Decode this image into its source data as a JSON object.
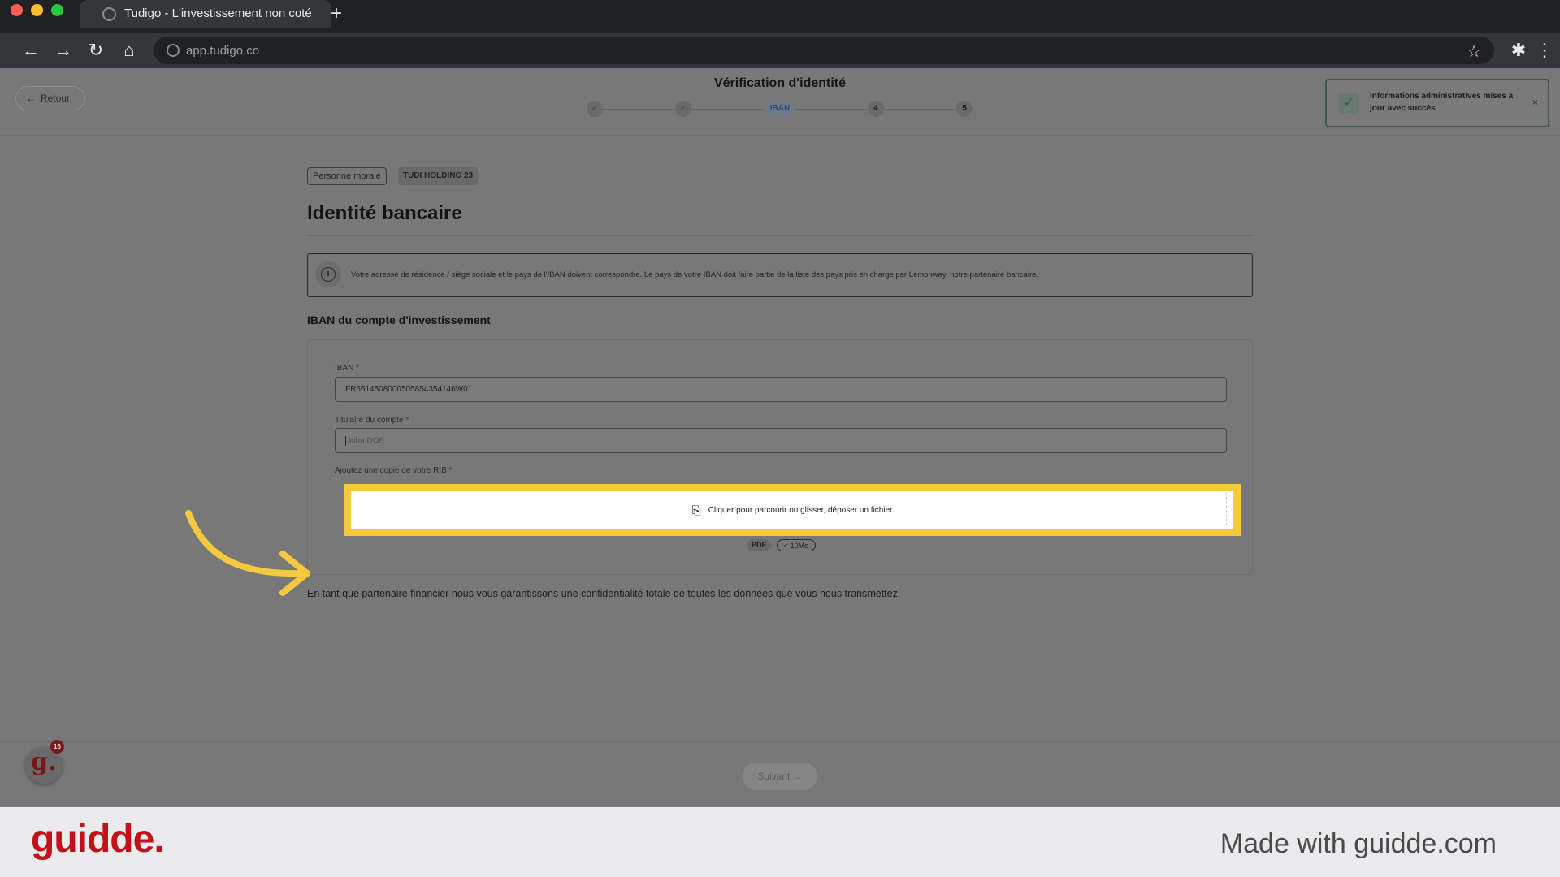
{
  "browser": {
    "tab_title": "Tudigo - L'investissement non coté",
    "new_tab": "+",
    "url": "app.tudigo.co",
    "colors": {
      "close": "#ff5f57",
      "minimize": "#febc2e",
      "maximize": "#28c840"
    }
  },
  "header": {
    "back_label": "Retour",
    "title": "Vérification d'identité",
    "steps": [
      {
        "state": "done",
        "label": "✓"
      },
      {
        "state": "done",
        "label": "✓"
      },
      {
        "state": "active",
        "label": "IBAN"
      },
      {
        "state": "todo",
        "label": "4"
      },
      {
        "state": "todo",
        "label": "5"
      }
    ]
  },
  "toast": {
    "message": "Informations administratives mises à jour avec succès",
    "close": "×"
  },
  "badges": {
    "entity_type": "Personne morale",
    "entity_name": "TUDI HOLDING 23"
  },
  "main": {
    "title": "Identité bancaire",
    "info_icon": "i",
    "info_text": "Votre adresse de résidence / siège sociale et le pays de l'IBAN doivent correspondre. Le pays de votre IBAN doit faire partie de la liste des pays pris en charge par Lemonway, notre partenaire bancaire.",
    "section_title": "IBAN du compte d'investissement",
    "iban": {
      "label": "IBAN",
      "required": "*",
      "value": "FR6514508000505854354146W01"
    },
    "holder": {
      "label": "Titulaire du compte",
      "required": "*",
      "placeholder": "John DOE"
    },
    "rib": {
      "label": "Ajoutez une copie de votre RIB",
      "required": "*",
      "dropzone_text": "Cliquer pour parcourir ou glisser, déposer un fichier",
      "format": "PDF",
      "max_size": "< 10Mo"
    },
    "footnote": "En tant que partenaire financier nous vous garantissons une confidentialité totale de toutes les données que vous nous transmettez."
  },
  "footer": {
    "next_label": "Suivant",
    "avatar_letter": "g.",
    "notif_count": "16"
  },
  "branding": {
    "logo": "guidde.",
    "made_with": "Made with guidde.com"
  },
  "colors": {
    "highlight": "#f7c93f",
    "brand": "#c3111a",
    "success": "#3c5a4c"
  }
}
